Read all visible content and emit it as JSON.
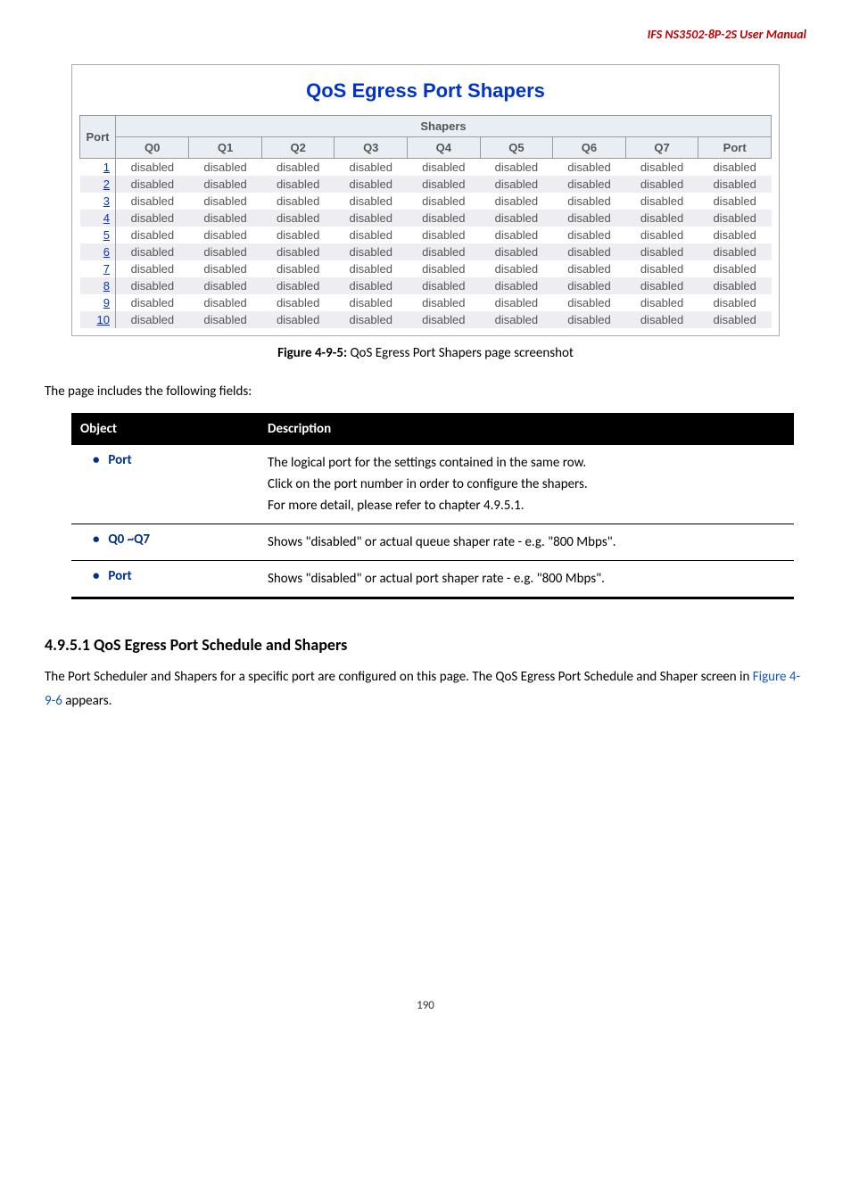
{
  "header": "IFS  NS3502-8P-2S  User Manual",
  "shapers_box": {
    "title": "QoS Egress Port Shapers",
    "port_header": "Port",
    "shapers_header": "Shapers",
    "cols": [
      "Q0",
      "Q1",
      "Q2",
      "Q3",
      "Q4",
      "Q5",
      "Q6",
      "Q7",
      "Port"
    ],
    "rows": [
      {
        "port": "1",
        "vals": [
          "disabled",
          "disabled",
          "disabled",
          "disabled",
          "disabled",
          "disabled",
          "disabled",
          "disabled",
          "disabled"
        ]
      },
      {
        "port": "2",
        "vals": [
          "disabled",
          "disabled",
          "disabled",
          "disabled",
          "disabled",
          "disabled",
          "disabled",
          "disabled",
          "disabled"
        ]
      },
      {
        "port": "3",
        "vals": [
          "disabled",
          "disabled",
          "disabled",
          "disabled",
          "disabled",
          "disabled",
          "disabled",
          "disabled",
          "disabled"
        ]
      },
      {
        "port": "4",
        "vals": [
          "disabled",
          "disabled",
          "disabled",
          "disabled",
          "disabled",
          "disabled",
          "disabled",
          "disabled",
          "disabled"
        ]
      },
      {
        "port": "5",
        "vals": [
          "disabled",
          "disabled",
          "disabled",
          "disabled",
          "disabled",
          "disabled",
          "disabled",
          "disabled",
          "disabled"
        ]
      },
      {
        "port": "6",
        "vals": [
          "disabled",
          "disabled",
          "disabled",
          "disabled",
          "disabled",
          "disabled",
          "disabled",
          "disabled",
          "disabled"
        ]
      },
      {
        "port": "7",
        "vals": [
          "disabled",
          "disabled",
          "disabled",
          "disabled",
          "disabled",
          "disabled",
          "disabled",
          "disabled",
          "disabled"
        ]
      },
      {
        "port": "8",
        "vals": [
          "disabled",
          "disabled",
          "disabled",
          "disabled",
          "disabled",
          "disabled",
          "disabled",
          "disabled",
          "disabled"
        ]
      },
      {
        "port": "9",
        "vals": [
          "disabled",
          "disabled",
          "disabled",
          "disabled",
          "disabled",
          "disabled",
          "disabled",
          "disabled",
          "disabled"
        ]
      },
      {
        "port": "10",
        "vals": [
          "disabled",
          "disabled",
          "disabled",
          "disabled",
          "disabled",
          "disabled",
          "disabled",
          "disabled",
          "disabled"
        ]
      }
    ]
  },
  "figure_caption_bold": "Figure 4-9-5:",
  "figure_caption_rest": " QoS Egress Port Shapers page screenshot",
  "intro": "The page includes the following fields:",
  "object_table": {
    "head_left": "Object",
    "head_right": "Description",
    "rows": [
      {
        "obj": "Port",
        "desc_lines": [
          "The logical port for the settings contained in the same row.",
          "Click on the port number in order to configure the shapers.",
          "For more detail, please refer to chapter 4.9.5.1."
        ]
      },
      {
        "obj": "Q0 ~Q7",
        "desc_lines": [
          "Shows \"disabled\" or actual queue shaper rate - e.g. \"800 Mbps\"."
        ]
      },
      {
        "obj": "Port",
        "desc_lines": [
          "Shows \"disabled\" or actual port shaper rate - e.g. \"800 Mbps\"."
        ]
      }
    ]
  },
  "section": {
    "heading": "4.9.5.1 QoS Egress Port Schedule and Shapers",
    "text_a": "The Port Scheduler and Shapers for a specific port are configured on this page. The QoS Egress Port Schedule and Shaper screen in ",
    "fig_link": "Figure 4-9-6",
    "text_b": " appears."
  },
  "page_number": "190"
}
